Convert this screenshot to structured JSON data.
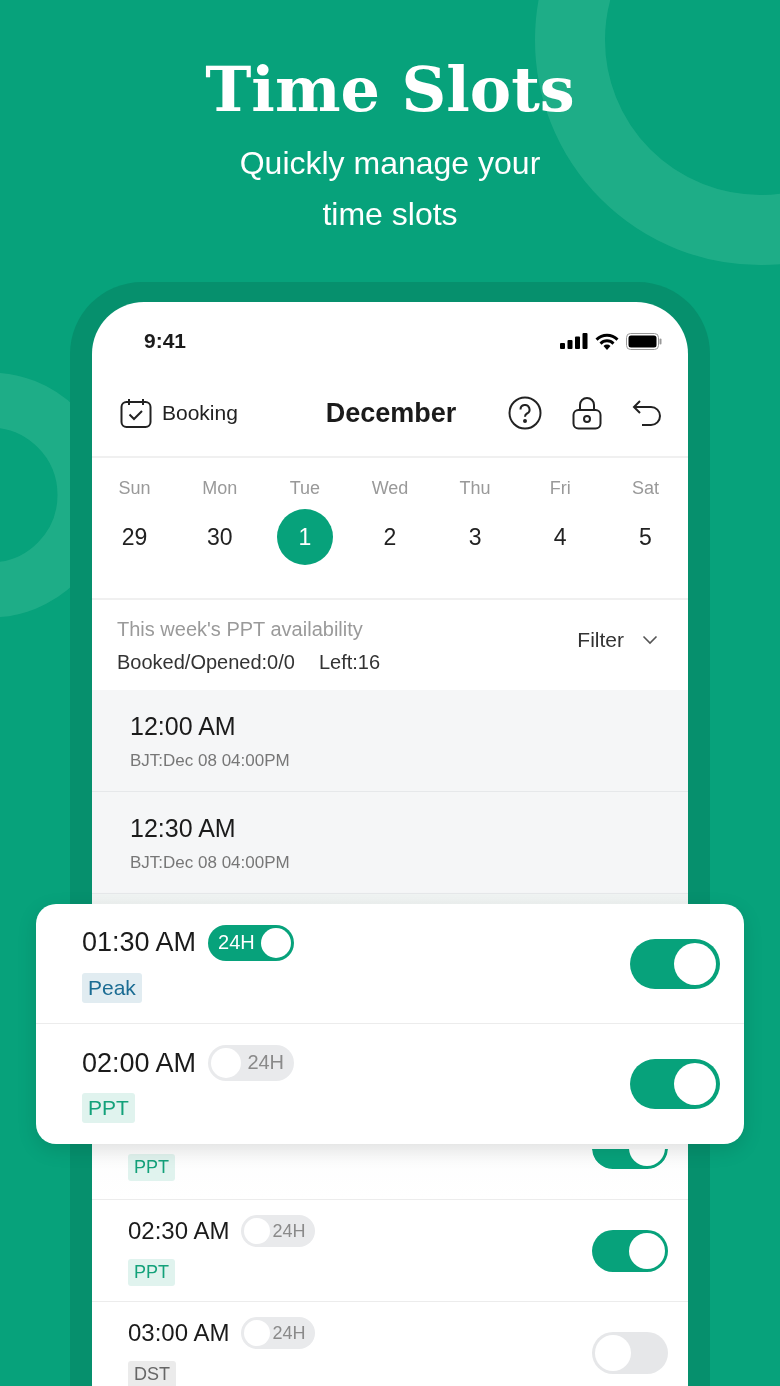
{
  "header": {
    "title": "Time Slots",
    "subtitle": "Quickly manage your time slots"
  },
  "status_bar": {
    "time": "9:41"
  },
  "top_bar": {
    "booking": "Booking",
    "month": "December"
  },
  "week": [
    {
      "day": "Sun",
      "date": "29",
      "selected": false
    },
    {
      "day": "Mon",
      "date": "30",
      "selected": false
    },
    {
      "day": "Tue",
      "date": "1",
      "selected": true
    },
    {
      "day": "Wed",
      "date": "2",
      "selected": false
    },
    {
      "day": "Thu",
      "date": "3",
      "selected": false
    },
    {
      "day": "Fri",
      "date": "4",
      "selected": false
    },
    {
      "day": "Sat",
      "date": "5",
      "selected": false
    }
  ],
  "summary": {
    "title": "This week's PPT availability",
    "booked": "Booked/Opened:0/0",
    "left": "Left:16",
    "filter": "Filter"
  },
  "closed_rows": [
    {
      "time": "12:00 AM",
      "local_time": "BJT:Dec 08 04:00PM"
    },
    {
      "time": "12:30 AM",
      "local_time": "BJT:Dec 08 04:00PM"
    }
  ],
  "covered_row": {
    "tag": "PPT",
    "color": "#13a17a",
    "on": true
  },
  "rows": [
    {
      "time": "02:30 AM",
      "h24": false,
      "switch_label": "24H",
      "tag": "PPT",
      "color": "#13a17a",
      "on": true
    },
    {
      "time": "03:00 AM",
      "h24": false,
      "switch_label": "24H",
      "tag": "DST",
      "color": "#666666",
      "on": false
    }
  ],
  "card_rows": [
    {
      "time": "01:30 AM",
      "h24": true,
      "switch_label": "24H",
      "tag": "Peak",
      "color": "#1b6c93",
      "on": true
    },
    {
      "time": "02:00 AM",
      "h24": false,
      "switch_label": "24H",
      "tag": "PPT",
      "color": "#13a17a",
      "on": true
    }
  ]
}
